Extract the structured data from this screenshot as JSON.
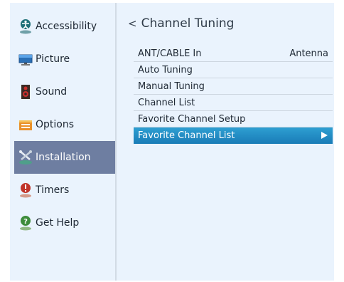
{
  "sidebar": {
    "items": [
      {
        "label": "Accessibility",
        "icon": "accessibility-icon"
      },
      {
        "label": "Picture",
        "icon": "picture-icon"
      },
      {
        "label": "Sound",
        "icon": "speaker-icon"
      },
      {
        "label": "Options",
        "icon": "options-icon"
      },
      {
        "label": "Installation",
        "icon": "installation-icon",
        "active": true
      },
      {
        "label": "Timers",
        "icon": "timer-icon"
      },
      {
        "label": "Get Help",
        "icon": "help-icon"
      }
    ]
  },
  "panel": {
    "back_glyph": "<",
    "title": "Channel Tuning",
    "rows": [
      {
        "label": "ANT/CABLE In",
        "value": "Antenna"
      },
      {
        "label": "Auto Tuning"
      },
      {
        "label": "Manual Tuning"
      },
      {
        "label": "Channel List"
      },
      {
        "label": "Favorite Channel Setup"
      },
      {
        "label": "Favorite Channel List",
        "selected": true,
        "has_arrow": true
      }
    ]
  },
  "colors": {
    "background": "#eaf3fd",
    "active_sidebar": "#6e7ea1",
    "selected_row": "#1f89c2"
  }
}
